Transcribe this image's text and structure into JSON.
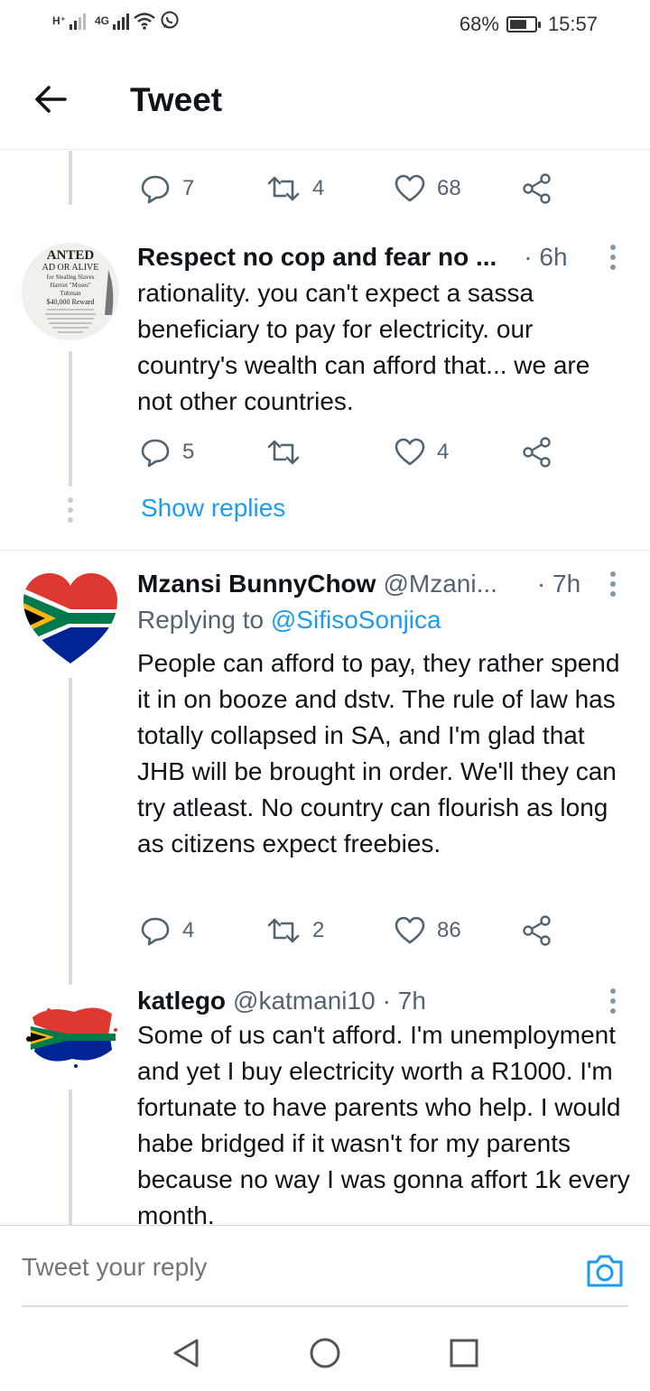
{
  "status": {
    "network_left": "H⁺",
    "network_right": "4G",
    "battery_percent": "68%",
    "battery_level": 0.68,
    "time": "15:57"
  },
  "header": {
    "title": "Tweet"
  },
  "top_actions": {
    "replies": "7",
    "retweets": "4",
    "likes": "68"
  },
  "tweets": [
    {
      "name": "Respect no cop and fear no ...",
      "handle": "",
      "time": "· 6h",
      "avatar_text": [
        "ANTED",
        "AD OR ALIVE",
        "for Stealing Slaves",
        "Harriet \"Moses\"",
        "Tubman",
        "$40,000 Reward"
      ],
      "body": "rationality. you can't expect a sassa beneficiary to pay for electricity. our country's wealth can afford that... we are not other countries.",
      "replies": "5",
      "retweets": "",
      "likes": "4",
      "show_replies": "Show replies"
    },
    {
      "name": "Mzansi BunnyChow",
      "handle": "@Mzani...",
      "time": "· 7h",
      "replying_label": "Replying to",
      "replying_to": "@SifisoSonjica",
      "body": "People can afford to pay, they rather spend it in on booze and dstv. The rule of law has totally collapsed in SA, and I'm glad that JHB will be brought in order. We'll they can try atleast. No country can flourish as long as citizens expect freebies.",
      "replies": "4",
      "retweets": "2",
      "likes": "86"
    },
    {
      "name": "katlego",
      "handle": "@katmani10",
      "time": "· 7h",
      "body": "Some of us can't afford.  I'm unemployment and yet I buy electricity worth a R1000. I'm fortunate to have parents who help. I would habe bridged if it wasn't for my parents because no way I was gonna affort 1k every month."
    }
  ],
  "reply_bar": {
    "placeholder": "Tweet your reply"
  },
  "colors": {
    "accent": "#1d9bf0",
    "muted": "#536471",
    "text": "#0f1419"
  }
}
